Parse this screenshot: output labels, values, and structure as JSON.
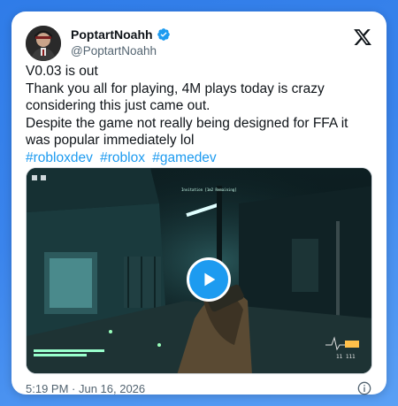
{
  "author": {
    "display_name": "PoptartNoahh",
    "handle": "@PoptartNoahh",
    "verified": true
  },
  "tweet": {
    "lines": [
      "V0.03 is out",
      "Thank you all for playing, 4M plays today is crazy considering this just came out.",
      "Despite the game not really being designed for FFA it was popular immediately lol"
    ],
    "hashtags": [
      "#robloxdev",
      "#roblox",
      "#gamedev"
    ],
    "timestamp": "5:19 PM · Jun 16, 2026"
  },
  "video": {
    "hud_top_text": "Invitation [1m2 Remaining]",
    "hud_ammo": "11 111"
  },
  "icons": {
    "brand": "x-logo-icon",
    "verified": "verified-badge-icon",
    "play": "play-icon",
    "info": "info-icon"
  },
  "colors": {
    "background": "#3a84ec",
    "link": "#1d9bf0",
    "text": "#0f1419",
    "secondary_text": "#536471"
  }
}
